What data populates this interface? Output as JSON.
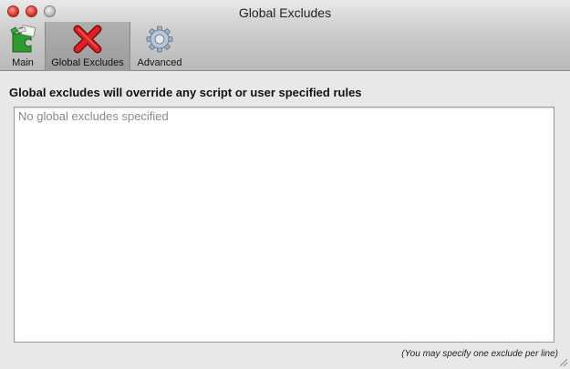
{
  "window": {
    "title": "Global Excludes"
  },
  "toolbar": {
    "items": [
      {
        "label": "Main",
        "icon": "puzzle-icon"
      },
      {
        "label": "Global Excludes",
        "icon": "red-x-icon"
      },
      {
        "label": "Advanced",
        "icon": "gear-icon"
      }
    ]
  },
  "main": {
    "heading": "Global excludes will override any script or user specified rules",
    "excludes_placeholder": "No global excludes specified",
    "hint": "(You may specify one exclude per line)"
  }
}
